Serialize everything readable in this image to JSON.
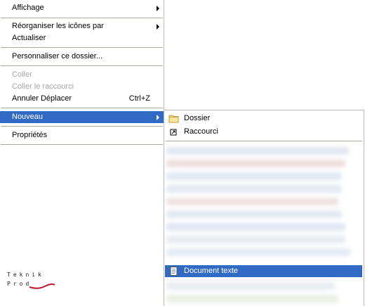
{
  "main_menu": {
    "items": [
      {
        "label": "Affichage",
        "has_submenu": true
      },
      {
        "label": "Réorganiser les icônes par",
        "has_submenu": true
      },
      {
        "label": "Actualiser"
      },
      {
        "label": "Personnaliser ce dossier..."
      },
      {
        "label": "Coller",
        "disabled": true
      },
      {
        "label": "Coller le raccourci",
        "disabled": true
      },
      {
        "label": "Annuler Déplacer",
        "shortcut": "Ctrl+Z"
      },
      {
        "label": "Nouveau",
        "has_submenu": true,
        "selected": true
      },
      {
        "label": "Propriétés"
      }
    ]
  },
  "submenu_new": {
    "items": [
      {
        "label": "Dossier",
        "icon": "folder-icon"
      },
      {
        "label": "Raccourci",
        "icon": "shortcut-icon"
      },
      {
        "label": "Document texte",
        "icon": "text-document-icon",
        "selected": true
      }
    ]
  },
  "watermark": {
    "line1": "Teknik",
    "line2": "Prod"
  },
  "colors": {
    "selection": "#316ac5",
    "separator": "#aca899",
    "disabled_text": "#a7a6aa",
    "border": "#b9b9b9"
  }
}
